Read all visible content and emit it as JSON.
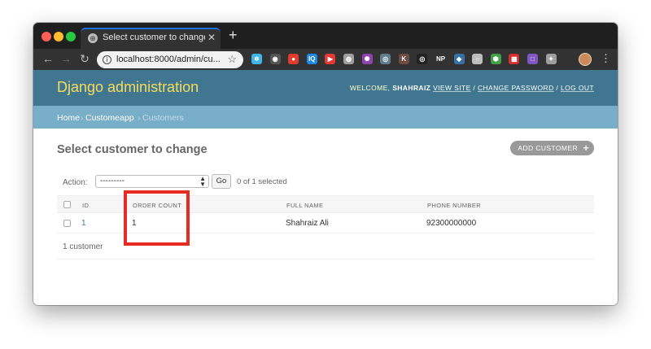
{
  "browser": {
    "tab_title": "Select customer to change | Dja",
    "url": "localhost:8000/admin/cu...",
    "extensions": [
      {
        "name": "react-icon",
        "color": "#3fb6e7",
        "glyph": "⚛"
      },
      {
        "name": "camera-icon",
        "color": "#555555",
        "glyph": "◉"
      },
      {
        "name": "record-icon",
        "color": "#e33b2e",
        "glyph": "●"
      },
      {
        "name": "iq-icon",
        "color": "#1e88e5",
        "glyph": "IQ"
      },
      {
        "name": "play-icon",
        "color": "#e53935",
        "glyph": "▶"
      },
      {
        "name": "globe-icon",
        "color": "#9e9e9e",
        "glyph": "◍"
      },
      {
        "name": "color-wheel-icon",
        "color": "#8e44ad",
        "glyph": "✺"
      },
      {
        "name": "chrome-icon",
        "color": "#607d8b",
        "glyph": "◎"
      },
      {
        "name": "k-icon",
        "color": "#6d4c41",
        "glyph": "K"
      },
      {
        "name": "target-icon",
        "color": "#212121",
        "glyph": "◎"
      },
      {
        "name": "np-icon",
        "color": "#323232",
        "glyph": "NP"
      },
      {
        "name": "python-icon",
        "color": "#3572a5",
        "glyph": "◆"
      },
      {
        "name": "circle-icon",
        "color": "#bdbdbd",
        "glyph": "○"
      },
      {
        "name": "shield-badge-icon",
        "color": "#43a047",
        "glyph": "⬢"
      },
      {
        "name": "grid-icon",
        "color": "#d32f2f",
        "glyph": "▦"
      },
      {
        "name": "square-icon",
        "color": "#7e57c2",
        "glyph": "□"
      },
      {
        "name": "compass-icon",
        "color": "#9e9e9e",
        "glyph": "✦"
      }
    ]
  },
  "header": {
    "branding": "Django administration",
    "welcome": "WELCOME,",
    "username": "SHAHRAIZ",
    "view_site": "VIEW SITE",
    "change_password": "CHANGE PASSWORD",
    "log_out": "LOG OUT",
    "separator": "/"
  },
  "breadcrumbs": {
    "home": "Home",
    "app": "Customeapp",
    "current": "Customers",
    "separator": "›"
  },
  "content": {
    "title": "Select customer to change",
    "add_button": "ADD CUSTOMER",
    "add_icon": "+"
  },
  "actions": {
    "label": "Action:",
    "selected_value": "---------",
    "go_label": "Go",
    "selected_count": "0 of 1 selected"
  },
  "table": {
    "columns": [
      "ID",
      "ORDER COUNT",
      "FULL NAME",
      "PHONE NUMBER"
    ],
    "rows": [
      {
        "id": "1",
        "order_count": "1",
        "full_name": "Shahraiz Ali",
        "phone": "92300000000"
      }
    ]
  },
  "footer": {
    "count": "1 customer"
  },
  "colors": {
    "header_bg": "#417690",
    "branding": "#f5dd5d",
    "breadcrumb_bg": "#79aec8",
    "link": "#447e9b",
    "highlight": "#e52b24"
  }
}
